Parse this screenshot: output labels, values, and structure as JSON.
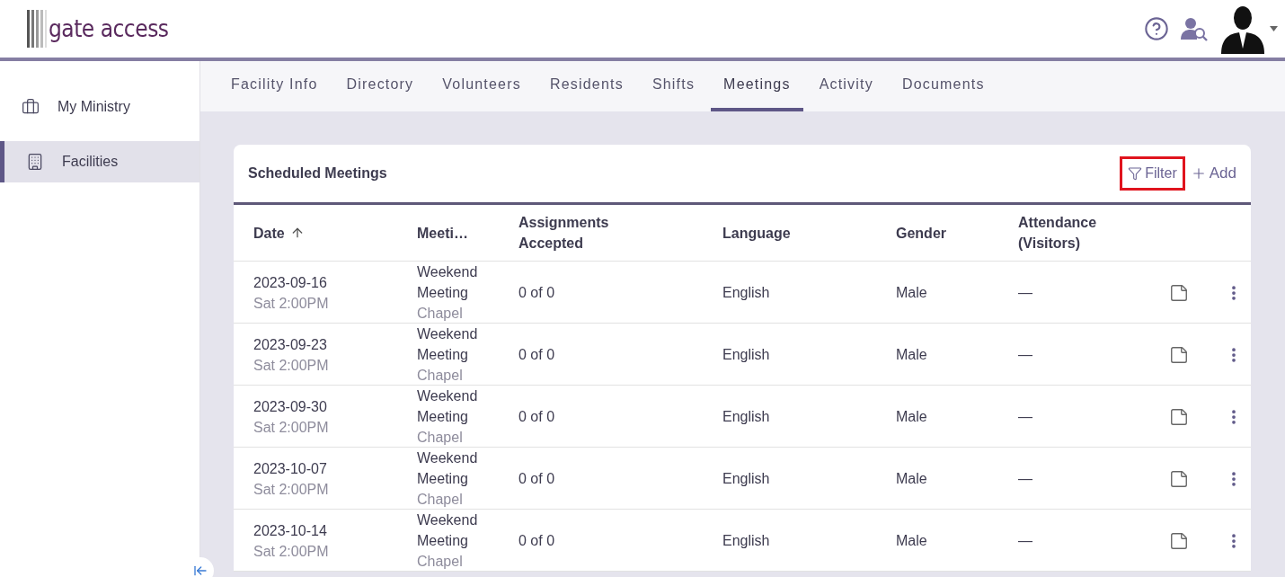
{
  "header": {
    "logo_text": "gate access"
  },
  "sidebar": {
    "items": [
      {
        "label": "My Ministry",
        "selected": false
      },
      {
        "label": "Facilities",
        "selected": true
      }
    ]
  },
  "tabs": [
    {
      "label": "Facility Info",
      "selected": false
    },
    {
      "label": "Directory",
      "selected": false
    },
    {
      "label": "Volunteers",
      "selected": false
    },
    {
      "label": "Residents",
      "selected": false
    },
    {
      "label": "Shifts",
      "selected": false
    },
    {
      "label": "Meetings",
      "selected": true
    },
    {
      "label": "Activity",
      "selected": false
    },
    {
      "label": "Documents",
      "selected": false
    }
  ],
  "card": {
    "title": "Scheduled Meetings",
    "filter": {
      "label": "Filter",
      "highlighted": true
    },
    "add": {
      "label": "Add"
    }
  },
  "table": {
    "columns": [
      {
        "label": "Date",
        "sorted_ascending": true
      },
      {
        "label": "Meeti…"
      },
      {
        "label": "Assignments Accepted"
      },
      {
        "label": "Language"
      },
      {
        "label": "Gender"
      },
      {
        "label": "Attendance (Visitors)"
      }
    ],
    "rows": [
      {
        "date": "2023-09-16",
        "time": "Sat 2:00PM",
        "meeting": "Weekend Meeting",
        "location": "Chapel",
        "assignments": "0 of 0",
        "language": "English",
        "gender": "Male",
        "attendance": "—"
      },
      {
        "date": "2023-09-23",
        "time": "Sat 2:00PM",
        "meeting": "Weekend Meeting",
        "location": "Chapel",
        "assignments": "0 of 0",
        "language": "English",
        "gender": "Male",
        "attendance": "—"
      },
      {
        "date": "2023-09-30",
        "time": "Sat 2:00PM",
        "meeting": "Weekend Meeting",
        "location": "Chapel",
        "assignments": "0 of 0",
        "language": "English",
        "gender": "Male",
        "attendance": "—"
      },
      {
        "date": "2023-10-07",
        "time": "Sat 2:00PM",
        "meeting": "Weekend Meeting",
        "location": "Chapel",
        "assignments": "0 of 0",
        "language": "English",
        "gender": "Male",
        "attendance": "—"
      },
      {
        "date": "2023-10-14",
        "time": "Sat 2:00PM",
        "meeting": "Weekend Meeting",
        "location": "Chapel",
        "assignments": "0 of 0",
        "language": "English",
        "gender": "Male",
        "attendance": "—"
      }
    ]
  }
}
